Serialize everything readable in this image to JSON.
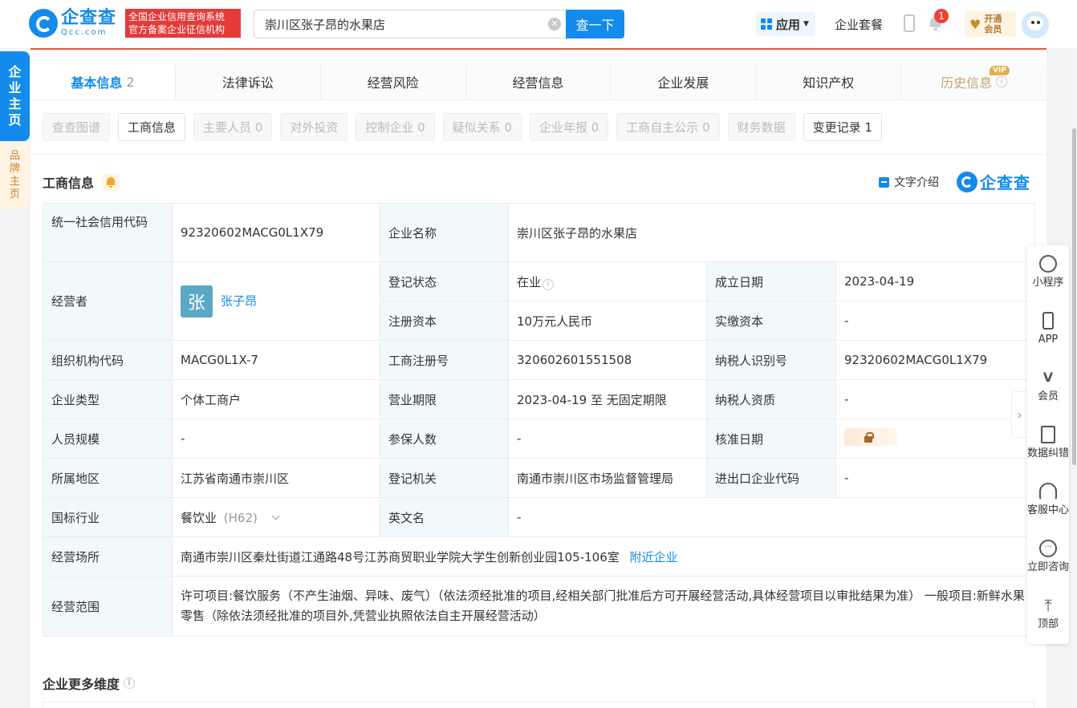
{
  "header": {
    "logo_cn": "企查查",
    "logo_en": "Qcc.com",
    "slogan_line1": "全国企业信用查询系统",
    "slogan_line2": "官方备案企业征信机构",
    "search_value": "崇川区张子昂的水果店",
    "search_button": "查一下",
    "apps_label": "应用",
    "package_link": "企业套餐",
    "notification_count": "1",
    "vip_label": "开通会员"
  },
  "side_tabs": {
    "main": [
      "企",
      "业",
      "主",
      "页"
    ],
    "brand": [
      "品",
      "牌",
      "主",
      "页"
    ]
  },
  "main_tabs": [
    {
      "label": "基本信息",
      "count": "2"
    },
    {
      "label": "法律诉讼",
      "count": ""
    },
    {
      "label": "经营风险",
      "count": ""
    },
    {
      "label": "经营信息",
      "count": ""
    },
    {
      "label": "企业发展",
      "count": ""
    },
    {
      "label": "知识产权",
      "count": ""
    },
    {
      "label": "历史信息",
      "count": "",
      "badge": "VIP"
    }
  ],
  "sub_tabs": [
    "查查图谱",
    "工商信息",
    "主要人员 0",
    "对外投资",
    "控制企业 0",
    "疑似关系 0",
    "企业年报 0",
    "工商自主公示 0",
    "财务数据",
    "变更记录 1"
  ],
  "section": {
    "title": "工商信息",
    "text_intro": "文字介绍",
    "brand_mini": "企查查"
  },
  "info": {
    "credit_code_k": "统一社会信用代码",
    "credit_code_v": "92320602MACG0L1X79",
    "name_k": "企业名称",
    "name_v": "崇川区张子昂的水果店",
    "operator_k": "经营者",
    "operator_avatar": "张",
    "operator_v": "张子昂",
    "status_k": "登记状态",
    "status_v": "在业",
    "established_k": "成立日期",
    "established_v": "2023-04-19",
    "capital_k": "注册资本",
    "capital_v": "10万元人民币",
    "paid_capital_k": "实缴资本",
    "paid_capital_v": "-",
    "org_code_k": "组织机构代码",
    "org_code_v": "MACG0L1X-7",
    "reg_no_k": "工商注册号",
    "reg_no_v": "320602601551508",
    "taxpayer_id_k": "纳税人识别号",
    "taxpayer_id_v": "92320602MACG0L1X79",
    "type_k": "企业类型",
    "type_v": "个体工商户",
    "term_k": "营业期限",
    "term_v": "2023-04-19 至 无固定期限",
    "taxpayer_qual_k": "纳税人资质",
    "taxpayer_qual_v": "-",
    "staff_k": "人员规模",
    "staff_v": "-",
    "insured_k": "参保人数",
    "insured_v": "-",
    "approved_k": "核准日期",
    "region_k": "所属地区",
    "region_v": "江苏省南通市崇川区",
    "authority_k": "登记机关",
    "authority_v": "南通市崇川区市场监督管理局",
    "ie_code_k": "进出口企业代码",
    "ie_code_v": "-",
    "industry_k": "国标行业",
    "industry_v": "餐饮业",
    "industry_code": "(H62)",
    "english_k": "英文名",
    "english_v": "-",
    "address_k": "经营场所",
    "address_v": "南通市崇川区秦灶街道江通路48号江苏商贸职业学院大学生创新创业园105-106室",
    "address_link": "附近企业",
    "scope_k": "经营范围",
    "scope_v": "许可项目:餐饮服务（不产生油烟、异味、废气）（依法须经批准的项目,经相关部门批准后方可开展经营活动,具体经营项目以审批结果为准） 一般项目:新鲜水果零售（除依法须经批准的项目外,凭营业执照依法自主开展经营活动）"
  },
  "more_title": "企业更多维度",
  "right_rail": [
    "小程序",
    "APP",
    "会员",
    "数据纠错",
    "客服中心",
    "立即咨询",
    "顶部"
  ]
}
